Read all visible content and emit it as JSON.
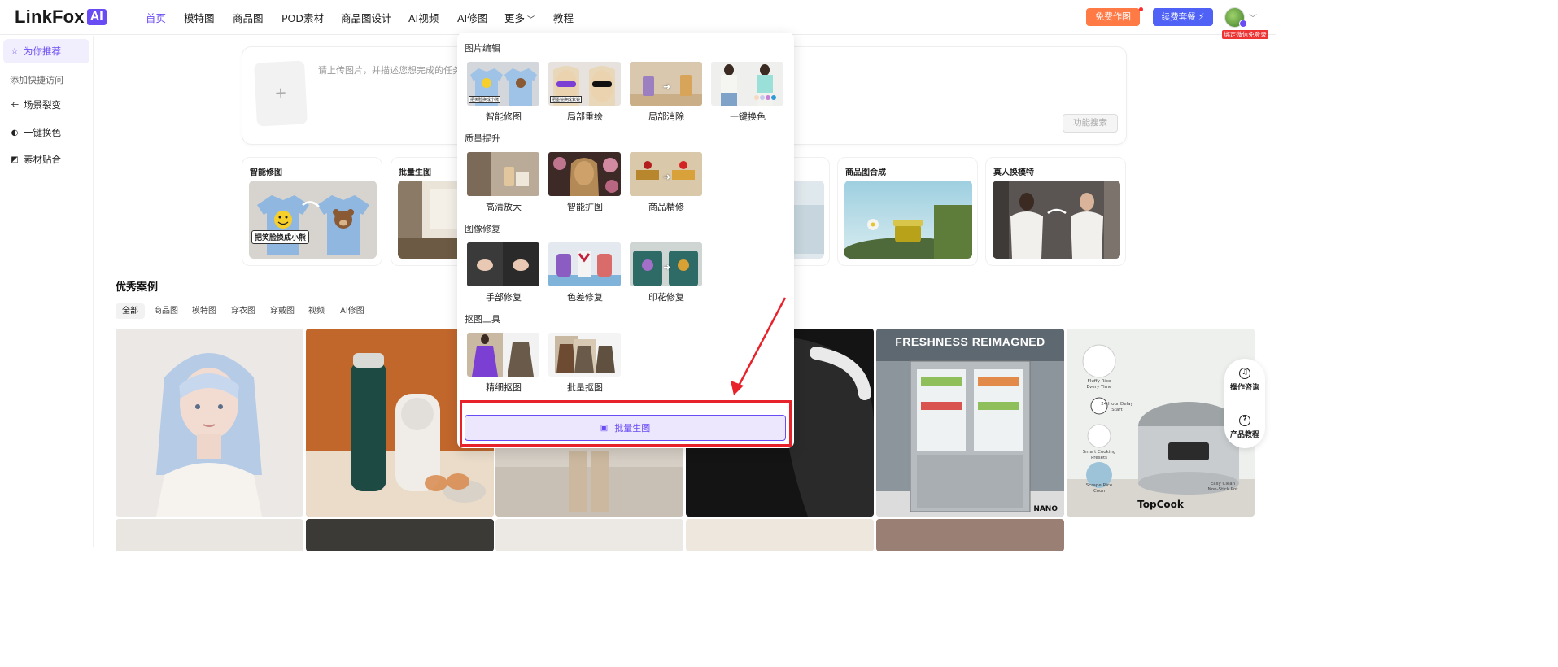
{
  "logo": {
    "text": "LinkFox",
    "badge": "AI"
  },
  "nav": {
    "items": [
      "首页",
      "模特图",
      "商品图",
      "POD素材",
      "商品图设计",
      "AI视频",
      "AI修图",
      "更多",
      "教程"
    ],
    "free_btn": "免费作图",
    "renew_btn": "续费套餐 ⚡",
    "bind_tag": "绑定微信免登录"
  },
  "sidebar": {
    "recommend": "为你推荐",
    "add_quick": "添加快捷访问",
    "items": [
      "场景裂变",
      "一键换色",
      "素材贴合"
    ]
  },
  "prompt": {
    "placeholder": "请上传图片，并描述您想完成的任务",
    "plus": "+",
    "search_btn": "功能搜索"
  },
  "features": [
    {
      "title": "智能修图",
      "tag": "把笑脸换成小熊"
    },
    {
      "title": "批量生图"
    },
    {
      "title": "商品图合成"
    },
    {
      "title": "真人换模特"
    }
  ],
  "cases": {
    "title": "优秀案例",
    "tabs": [
      "全部",
      "商品图",
      "模特图",
      "穿衣图",
      "穿戴图",
      "视频",
      "AI修图"
    ],
    "tile_texts": {
      "fridge_title": "FRESHNESS REIMAGNED",
      "fridge_brand": "NANO",
      "cooker_brand": "TopCook",
      "cooker_features": [
        "Fluffy Rice Every Time",
        "24 Hour Delay Start",
        "Smart Cooking Presets",
        "Easy Clean Non-Stick Pot",
        "Scrape Rice Coon"
      ]
    }
  },
  "helper": {
    "consult": "操作咨询",
    "tutorial": "产品教程"
  },
  "dropdown": {
    "sections": [
      {
        "title": "图片编辑",
        "items": [
          "智能修图",
          "局部重绘",
          "局部消除",
          "一键换色"
        ]
      },
      {
        "title": "质量提升",
        "items": [
          "高清放大",
          "智能扩图",
          "商品精修"
        ]
      },
      {
        "title": "图像修复",
        "items": [
          "手部修复",
          "色差修复",
          "印花修复"
        ]
      },
      {
        "title": "抠图工具",
        "items": [
          "精细抠图",
          "批量抠图"
        ]
      }
    ],
    "thumb_tags": {
      "smart": "把笑脸换成小熊",
      "redraw": "把墨镜换成紫镜"
    },
    "batch_btn": "批量生图"
  }
}
